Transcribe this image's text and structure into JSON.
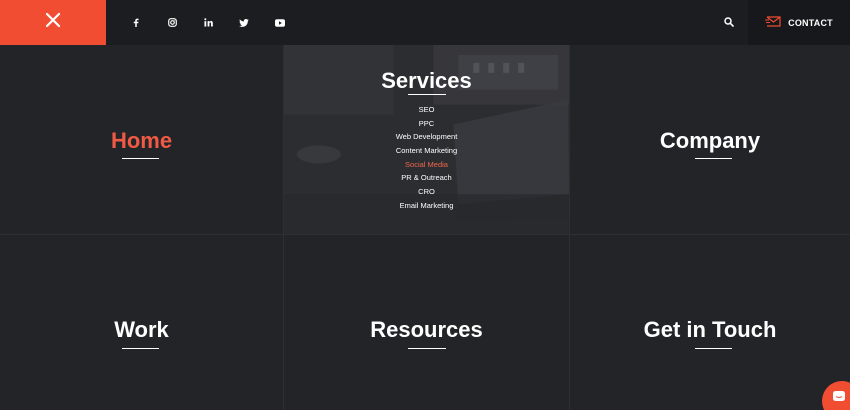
{
  "header": {
    "close_icon": "close-icon",
    "social_icons": [
      "facebook-icon",
      "instagram-icon",
      "linkedin-icon",
      "twitter-icon",
      "youtube-icon"
    ],
    "search_icon": "search-icon",
    "contact": {
      "icon": "envelope-icon",
      "label": "CONTACT"
    }
  },
  "menu": {
    "home": "Home",
    "services": {
      "title": "Services",
      "items": [
        "SEO",
        "PPC",
        "Web Development",
        "Content Marketing",
        "Social Media",
        "PR & Outreach",
        "CRO",
        "Email Marketing"
      ],
      "active_item": "Social Media"
    },
    "company": "Company",
    "work": "Work",
    "resources": "Resources",
    "get_in_touch": "Get in Touch"
  },
  "chat": {
    "icon": "chat-icon"
  },
  "colors": {
    "accent": "#f04d32",
    "active_text": "#f05a45",
    "background": "#232428",
    "header_bg": "#1c1d20"
  }
}
